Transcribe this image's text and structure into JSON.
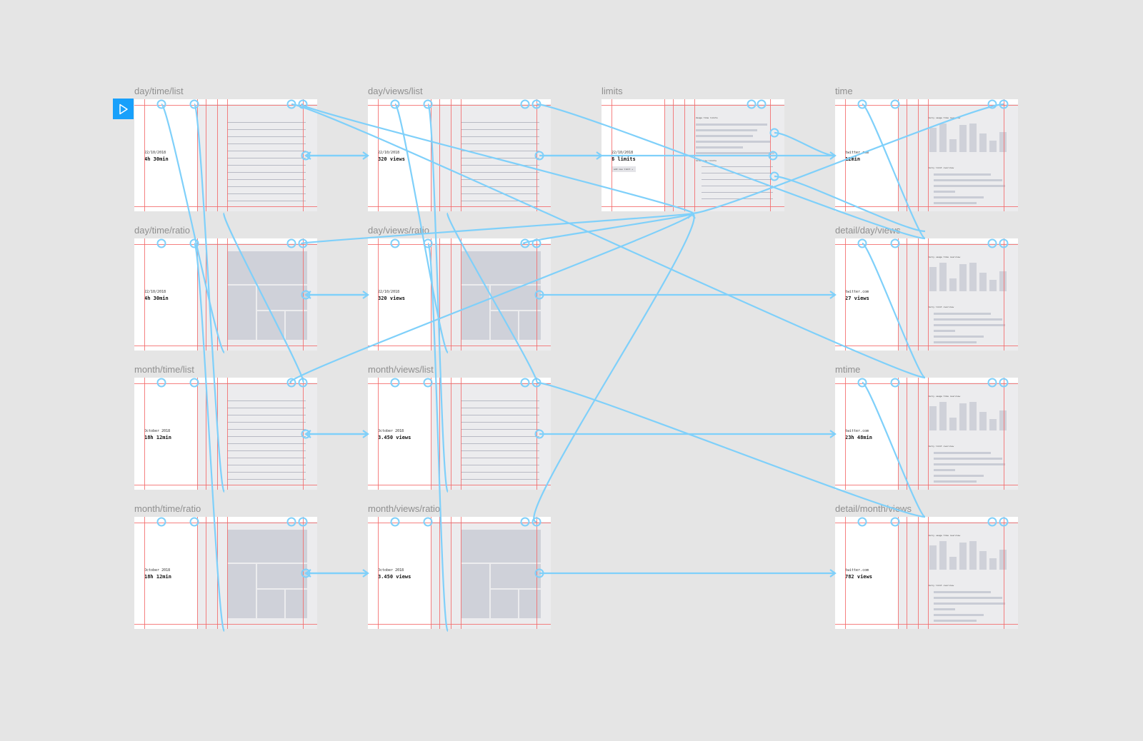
{
  "colors": {
    "canvas": "#e5e5e5",
    "flow_line": "#7fd0fa",
    "grid_line": "#f36b6b",
    "placeholder": "#cfd1d9",
    "play_button": "#18a0fb"
  },
  "play_button": {
    "icon": "play-icon"
  },
  "artboards": [
    {
      "id": "dtl",
      "label": "day/time/list",
      "type": "list",
      "date": "22/10/2018",
      "metric": "4h 30min"
    },
    {
      "id": "dvl",
      "label": "day/views/list",
      "type": "list",
      "date": "22/10/2018",
      "metric": "320 views"
    },
    {
      "id": "lim",
      "label": "limits",
      "type": "limits",
      "date": "22/10/2018",
      "metric": "6 limits",
      "button": "add new limit +",
      "sec1": "Usage time limits",
      "sec2": "Site view limits"
    },
    {
      "id": "tim",
      "label": "time",
      "type": "detail",
      "date": "twitter.com",
      "metric": "12min",
      "sec1": "Daily usage time overview",
      "sec2": "Daily limit overview"
    },
    {
      "id": "dtr",
      "label": "day/time/ratio",
      "type": "ratio",
      "date": "22/10/2018",
      "metric": "4h 30min"
    },
    {
      "id": "dvr",
      "label": "day/views/ratio",
      "type": "ratio",
      "date": "22/10/2018",
      "metric": "320 views"
    },
    {
      "id": "ddv",
      "label": "detail/day/views",
      "type": "detail",
      "date": "twitter.com",
      "metric": "27 views",
      "sec1": "Daily usage time overview",
      "sec2": "Daily limit overview"
    },
    {
      "id": "mtl",
      "label": "month/time/list",
      "type": "list",
      "date": "October 2018",
      "metric": "18h 12min"
    },
    {
      "id": "mvl",
      "label": "month/views/list",
      "type": "list",
      "date": "October 2018",
      "metric": "3.450 views"
    },
    {
      "id": "mti",
      "label": "mtime",
      "type": "detail",
      "date": "twitter.com",
      "metric": "23h 48min",
      "sec1": "Daily usage time overview",
      "sec2": "Daily limit overview"
    },
    {
      "id": "mtr",
      "label": "month/time/ratio",
      "type": "ratio",
      "date": "October 2018",
      "metric": "18h 12min"
    },
    {
      "id": "mvr",
      "label": "month/views/ratio",
      "type": "ratio",
      "date": "October 2018",
      "metric": "3.450 views"
    },
    {
      "id": "dmv",
      "label": "detail/month/views",
      "type": "detail",
      "date": "twitter.com",
      "metric": "782 views",
      "sec1": "Daily usage time overview",
      "sec2": "Daily limit overview"
    }
  ]
}
